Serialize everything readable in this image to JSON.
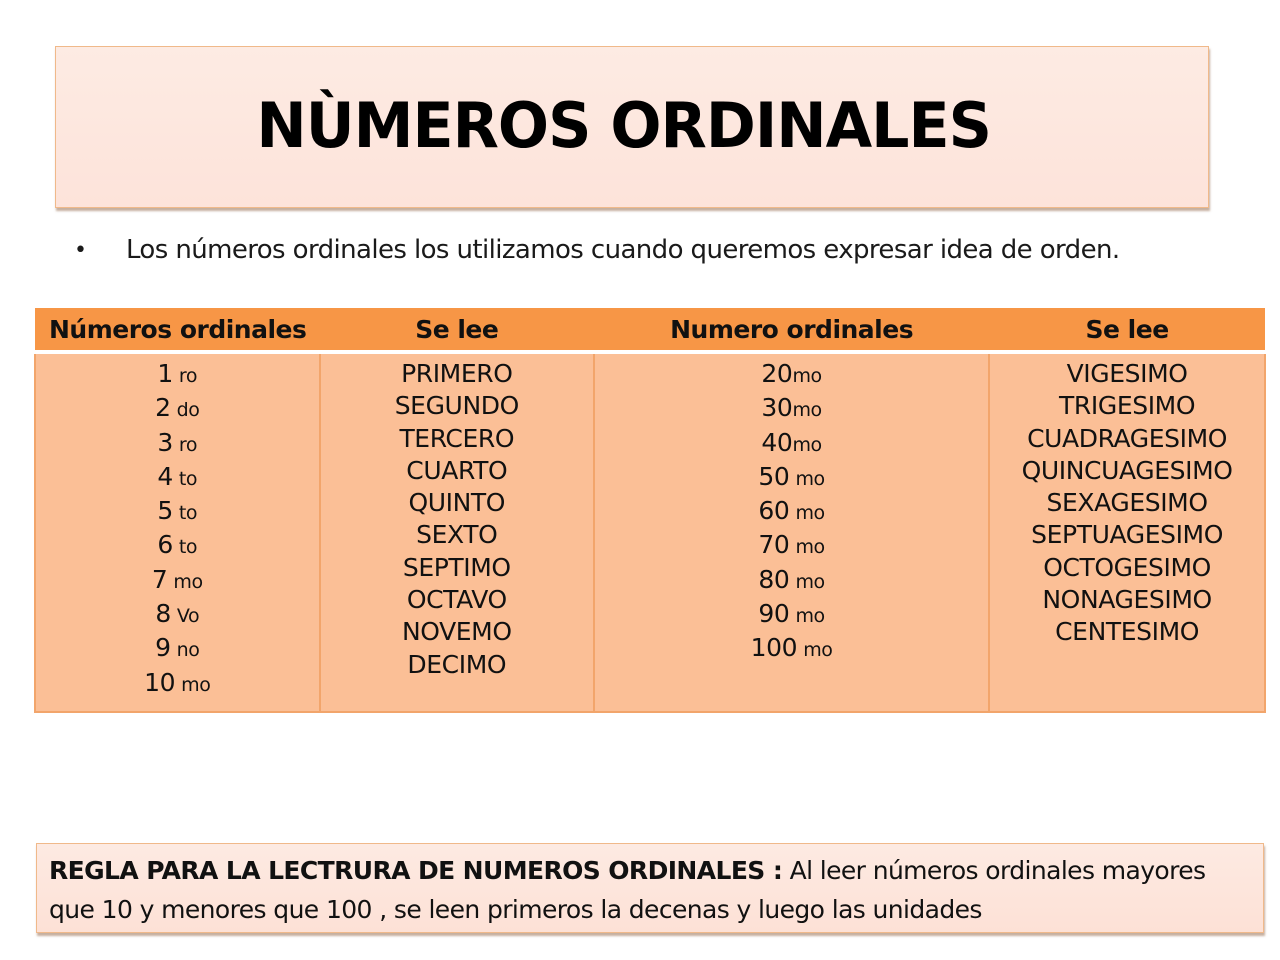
{
  "slide": {
    "title": "NÙMEROS ORDINALES",
    "bullet": {
      "icon": "bullet-dot",
      "symbol": "•",
      "text": "Los números ordinales los utilizamos cuando queremos expresar idea de orden."
    },
    "table": {
      "headers": [
        "Números ordinales",
        "Se lee",
        "Numero ordinales",
        "Se lee"
      ],
      "left_numbers": [
        {
          "num": "1",
          "suffix": "ro"
        },
        {
          "num": "2",
          "suffix": "do"
        },
        {
          "num": "3",
          "suffix": "ro"
        },
        {
          "num": "4",
          "suffix": "to"
        },
        {
          "num": "5",
          "suffix": "to"
        },
        {
          "num": "6",
          "suffix": "to"
        },
        {
          "num": "7",
          "suffix": "mo"
        },
        {
          "num": "8",
          "suffix": "Vo"
        },
        {
          "num": "9",
          "suffix": "no"
        },
        {
          "num": "10",
          "suffix": "mo"
        }
      ],
      "left_readings": [
        "PRIMERO",
        "SEGUNDO",
        "TERCERO",
        "CUARTO",
        "QUINTO",
        "SEXTO",
        "SEPTIMO",
        "OCTAVO",
        "NOVEMO",
        "DECIMO"
      ],
      "right_numbers": [
        {
          "num": "20",
          "suffix": "mo"
        },
        {
          "num": "30",
          "suffix": "mo"
        },
        {
          "num": "40",
          "suffix": "mo"
        },
        {
          "num": "50",
          "suffix": "mo"
        },
        {
          "num": "60",
          "suffix": "mo"
        },
        {
          "num": "70",
          "suffix": "mo"
        },
        {
          "num": "80",
          "suffix": "mo"
        },
        {
          "num": "90",
          "suffix": "mo"
        },
        {
          "num": "100",
          "suffix": "mo"
        }
      ],
      "right_readings": [
        "VIGESIMO",
        "TRIGESIMO",
        "CUADRAGESIMO",
        "QUINCUAGESIMO",
        "SEXAGESIMO",
        "SEPTUAGESIMO",
        "OCTOGESIMO",
        "NONAGESIMO",
        "CENTESIMO"
      ]
    },
    "rule": {
      "label": "REGLA PARA LA LECTRURA DE NUMEROS ORDINALES :",
      "text": " Al leer  números ordinales mayores que 10 y menores que 100 , se leen primeros la decenas y luego las unidades"
    },
    "colors": {
      "header_orange": "#f79646",
      "cell_peach": "#fbbf96",
      "box_pink": "#fde3da",
      "border_orange": "#f0b98a"
    }
  }
}
